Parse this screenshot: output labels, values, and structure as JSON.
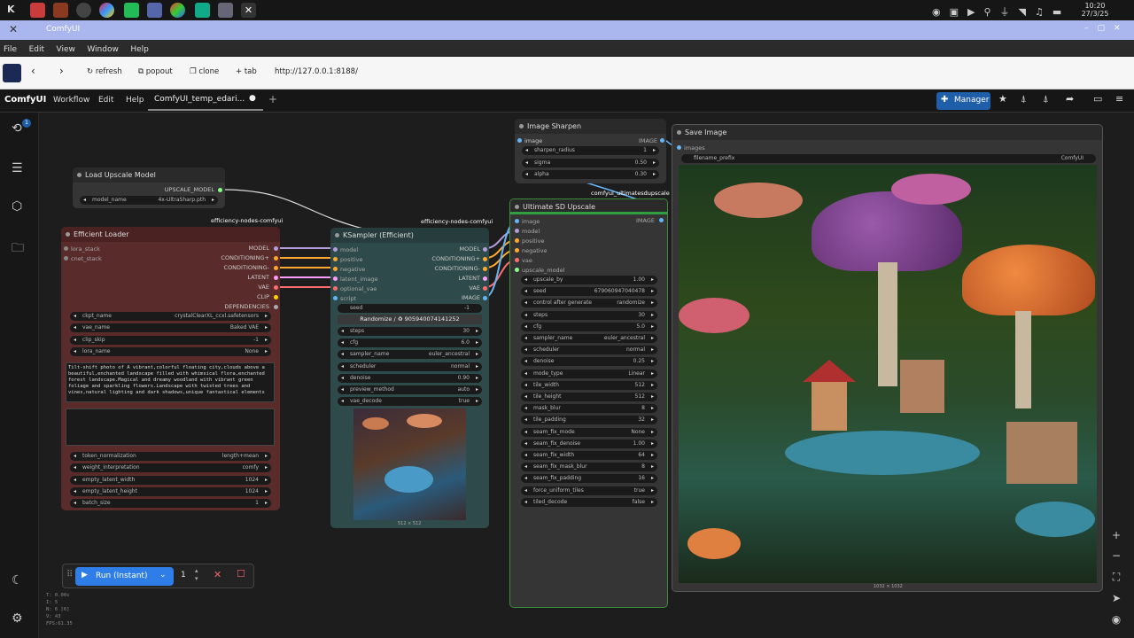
{
  "taskbar": {
    "clock": "10:20",
    "date": "27/3/25",
    "launcher": "K"
  },
  "window": {
    "title": "ComfyUI",
    "close": "✕"
  },
  "menubar": {
    "file": "File",
    "edit": "Edit",
    "view": "View",
    "window": "Window",
    "help": "Help"
  },
  "navbar": {
    "refresh": "refresh",
    "popout": "popout",
    "clone": "clone",
    "tab": "tab",
    "url": "http://127.0.0.1:8188/"
  },
  "comfy": {
    "brand": "ComfyUI",
    "workflow": "Workflow",
    "edit": "Edit",
    "help": "Help",
    "tab": "ComfyUI_temp_edari...",
    "manager": "Manager",
    "badge": "1"
  },
  "upscale_loader": {
    "title": "Load Upscale Model",
    "out": "UPSCALE_MODEL",
    "model_name": "model_name",
    "model_val": "4x-UltraSharp.pth",
    "group_label": "efficiency-nodes-comfyui"
  },
  "loader": {
    "title": "Efficient Loader",
    "inputs": [
      "lora_stack",
      "cnet_stack"
    ],
    "outputs": [
      "MODEL",
      "CONDITIONING+",
      "CONDITIONING-",
      "LATENT",
      "VAE",
      "CLIP",
      "DEPENDENCIES"
    ],
    "widgets_top": [
      {
        "n": "ckpt_name",
        "v": "crystalClearXL_ccxl.safetensors"
      },
      {
        "n": "vae_name",
        "v": "Baked VAE"
      },
      {
        "n": "clip_skip",
        "v": "-1"
      },
      {
        "n": "lora_name",
        "v": "None"
      }
    ],
    "prompt": "Tilt-shift photo of A vibrant,colorful floating city,clouds above a beautiful,enchanted landscape filled with whimsical flora,enchanted forest landscape.Magical and dreamy woodland with vibrant green foliage and sparkling flowers.Landscape with twisted trees and vines,natural lighting and dark shadows,unique fantastical elements",
    "widgets_bottom": [
      {
        "n": "token_normalization",
        "v": "length+mean"
      },
      {
        "n": "weight_interpretation",
        "v": "comfy"
      },
      {
        "n": "empty_latent_width",
        "v": "1024"
      },
      {
        "n": "empty_latent_height",
        "v": "1024"
      },
      {
        "n": "batch_size",
        "v": "1"
      }
    ]
  },
  "ksampler": {
    "title": "KSampler (Efficient)",
    "group_label": "efficiency-nodes-comfyui",
    "inputs": [
      "model",
      "positive",
      "negative",
      "latent_image",
      "optional_vae",
      "script"
    ],
    "outputs": [
      "MODEL",
      "CONDITIONING+",
      "CONDITIONING-",
      "LATENT",
      "VAE",
      "IMAGE"
    ],
    "seed_label": "seed",
    "seed_val": "-1",
    "randomize": "Randomize / ♻ 905940074141252",
    "widgets": [
      {
        "n": "steps",
        "v": "30"
      },
      {
        "n": "cfg",
        "v": "6.0"
      },
      {
        "n": "sampler_name",
        "v": "euler_ancestral"
      },
      {
        "n": "scheduler",
        "v": "normal"
      },
      {
        "n": "denoise",
        "v": "0.90"
      },
      {
        "n": "preview_method",
        "v": "auto"
      },
      {
        "n": "vae_decode",
        "v": "true"
      }
    ],
    "size": "512 × 512"
  },
  "sharpen": {
    "title": "Image Sharpen",
    "in": "image",
    "out": "IMAGE",
    "widgets": [
      {
        "n": "sharpen_radius",
        "v": "1"
      },
      {
        "n": "sigma",
        "v": "0.50"
      },
      {
        "n": "alpha",
        "v": "0.30"
      }
    ],
    "group_label": "comfyui_ultimatesdupscale"
  },
  "usd": {
    "title": "Ultimate SD Upscale",
    "out": "IMAGE",
    "inputs": [
      "image",
      "model",
      "positive",
      "negative",
      "vae",
      "upscale_model"
    ],
    "widgets": [
      {
        "n": "upscale_by",
        "v": "1.00"
      },
      {
        "n": "seed",
        "v": "679060947040478"
      },
      {
        "n": "control after generate",
        "v": "randomize"
      },
      {
        "n": "steps",
        "v": "30"
      },
      {
        "n": "cfg",
        "v": "5.0"
      },
      {
        "n": "sampler_name",
        "v": "euler_ancestral"
      },
      {
        "n": "scheduler",
        "v": "normal"
      },
      {
        "n": "denoise",
        "v": "0.25"
      },
      {
        "n": "mode_type",
        "v": "Linear"
      },
      {
        "n": "tile_width",
        "v": "512"
      },
      {
        "n": "tile_height",
        "v": "512"
      },
      {
        "n": "mask_blur",
        "v": "8"
      },
      {
        "n": "tile_padding",
        "v": "32"
      },
      {
        "n": "seam_fix_mode",
        "v": "None"
      },
      {
        "n": "seam_fix_denoise",
        "v": "1.00"
      },
      {
        "n": "seam_fix_width",
        "v": "64"
      },
      {
        "n": "seam_fix_mask_blur",
        "v": "8"
      },
      {
        "n": "seam_fix_padding",
        "v": "16"
      },
      {
        "n": "force_uniform_tiles",
        "v": "true"
      },
      {
        "n": "tiled_decode",
        "v": "false"
      }
    ]
  },
  "save": {
    "title": "Save Image",
    "in": "images",
    "prefix_label": "filename_prefix",
    "prefix_val": "ComfyUI",
    "size": "1032 × 1032"
  },
  "run": {
    "label": "Run (Instant)",
    "count": "1"
  },
  "stats": [
    "T: 0.00s",
    "I: 5",
    "N: 6 [6]",
    "V: 43",
    "FPS:61.35"
  ],
  "colors": {
    "accent": "#1f5ea8",
    "loader": "#5a2b2b",
    "ksampler": "#2f4a4a",
    "green": "#2ea043"
  }
}
